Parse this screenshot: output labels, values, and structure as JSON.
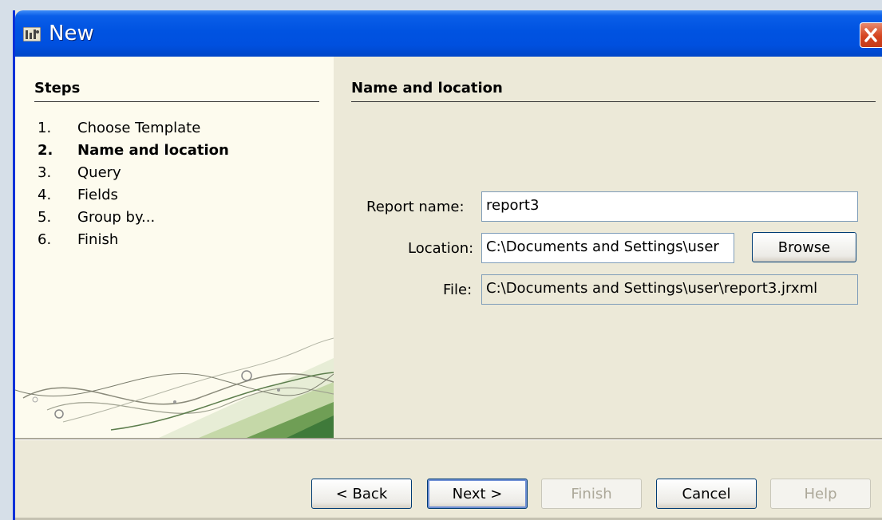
{
  "window": {
    "title": "New"
  },
  "steps": {
    "title": "Steps",
    "items": [
      {
        "num": "1.",
        "label": "Choose Template"
      },
      {
        "num": "2.",
        "label": "Name and location"
      },
      {
        "num": "3.",
        "label": "Query"
      },
      {
        "num": "4.",
        "label": "Fields"
      },
      {
        "num": "5.",
        "label": "Group by..."
      },
      {
        "num": "6.",
        "label": "Finish"
      }
    ]
  },
  "content": {
    "title": "Name and location",
    "report_name": {
      "label": "Report name:",
      "value": "report3"
    },
    "location": {
      "label": "Location:",
      "value": "C:\\Documents and Settings\\user"
    },
    "browse_label": "Browse",
    "file": {
      "label": "File:",
      "value": "C:\\Documents and Settings\\user\\report3.jrxml"
    }
  },
  "buttons": {
    "back": "< Back",
    "next": "Next >",
    "finish": "Finish",
    "cancel": "Cancel",
    "help": "Help"
  }
}
